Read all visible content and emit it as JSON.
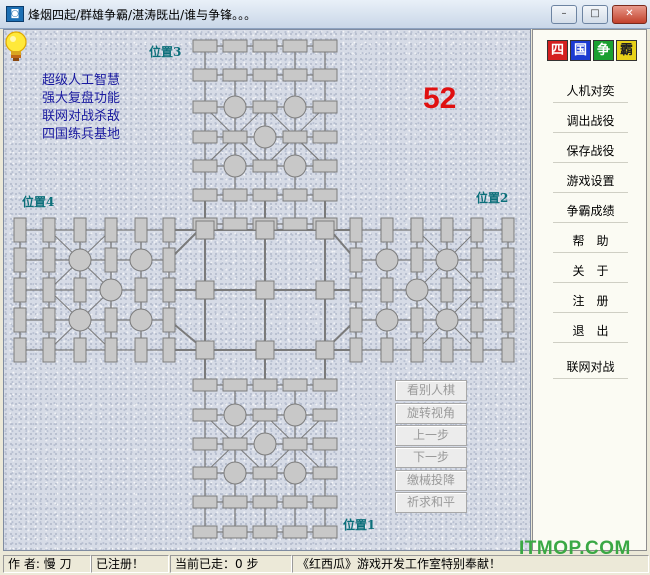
{
  "window": {
    "title": "烽烟四起/群雄争霸/湛涛既出/谁与争锋。。。",
    "icon": "app-icon",
    "controls": {
      "minimize": "–",
      "maximize": "□",
      "close": "✕"
    }
  },
  "board": {
    "positions": {
      "p1": "位置1",
      "p2": "位置2",
      "p3": "位置3",
      "p4": "位置4"
    },
    "features": [
      "超级人工智慧",
      "强大复盘功能",
      "联网对战杀敌",
      "四国练兵基地"
    ],
    "counter": "52",
    "game_buttons": [
      "看别人棋",
      "旋转视角",
      "上一步",
      "下一步",
      "缴械投降",
      "祈求和平"
    ],
    "hint_icon": "lightbulb-icon"
  },
  "menu": {
    "logo_chars": [
      "四",
      "国",
      "争",
      "霸"
    ],
    "logo_colors": [
      "#d42020",
      "#1c3bd1",
      "#1aa030",
      "#e8d21a"
    ],
    "items": [
      "人机对奕",
      "调出战役",
      "保存战役",
      "游戏设置",
      "争霸成绩",
      "帮　助",
      "关　于",
      "注　册",
      "退　出",
      "联网对战"
    ]
  },
  "status": {
    "author": "作 者: 慢 刀",
    "registered": "已注册！",
    "steps": "当前已走：0 步",
    "credits": "《红西瓜》游戏开发工作室特别奉献！"
  },
  "watermark": "ITMOP.COM"
}
